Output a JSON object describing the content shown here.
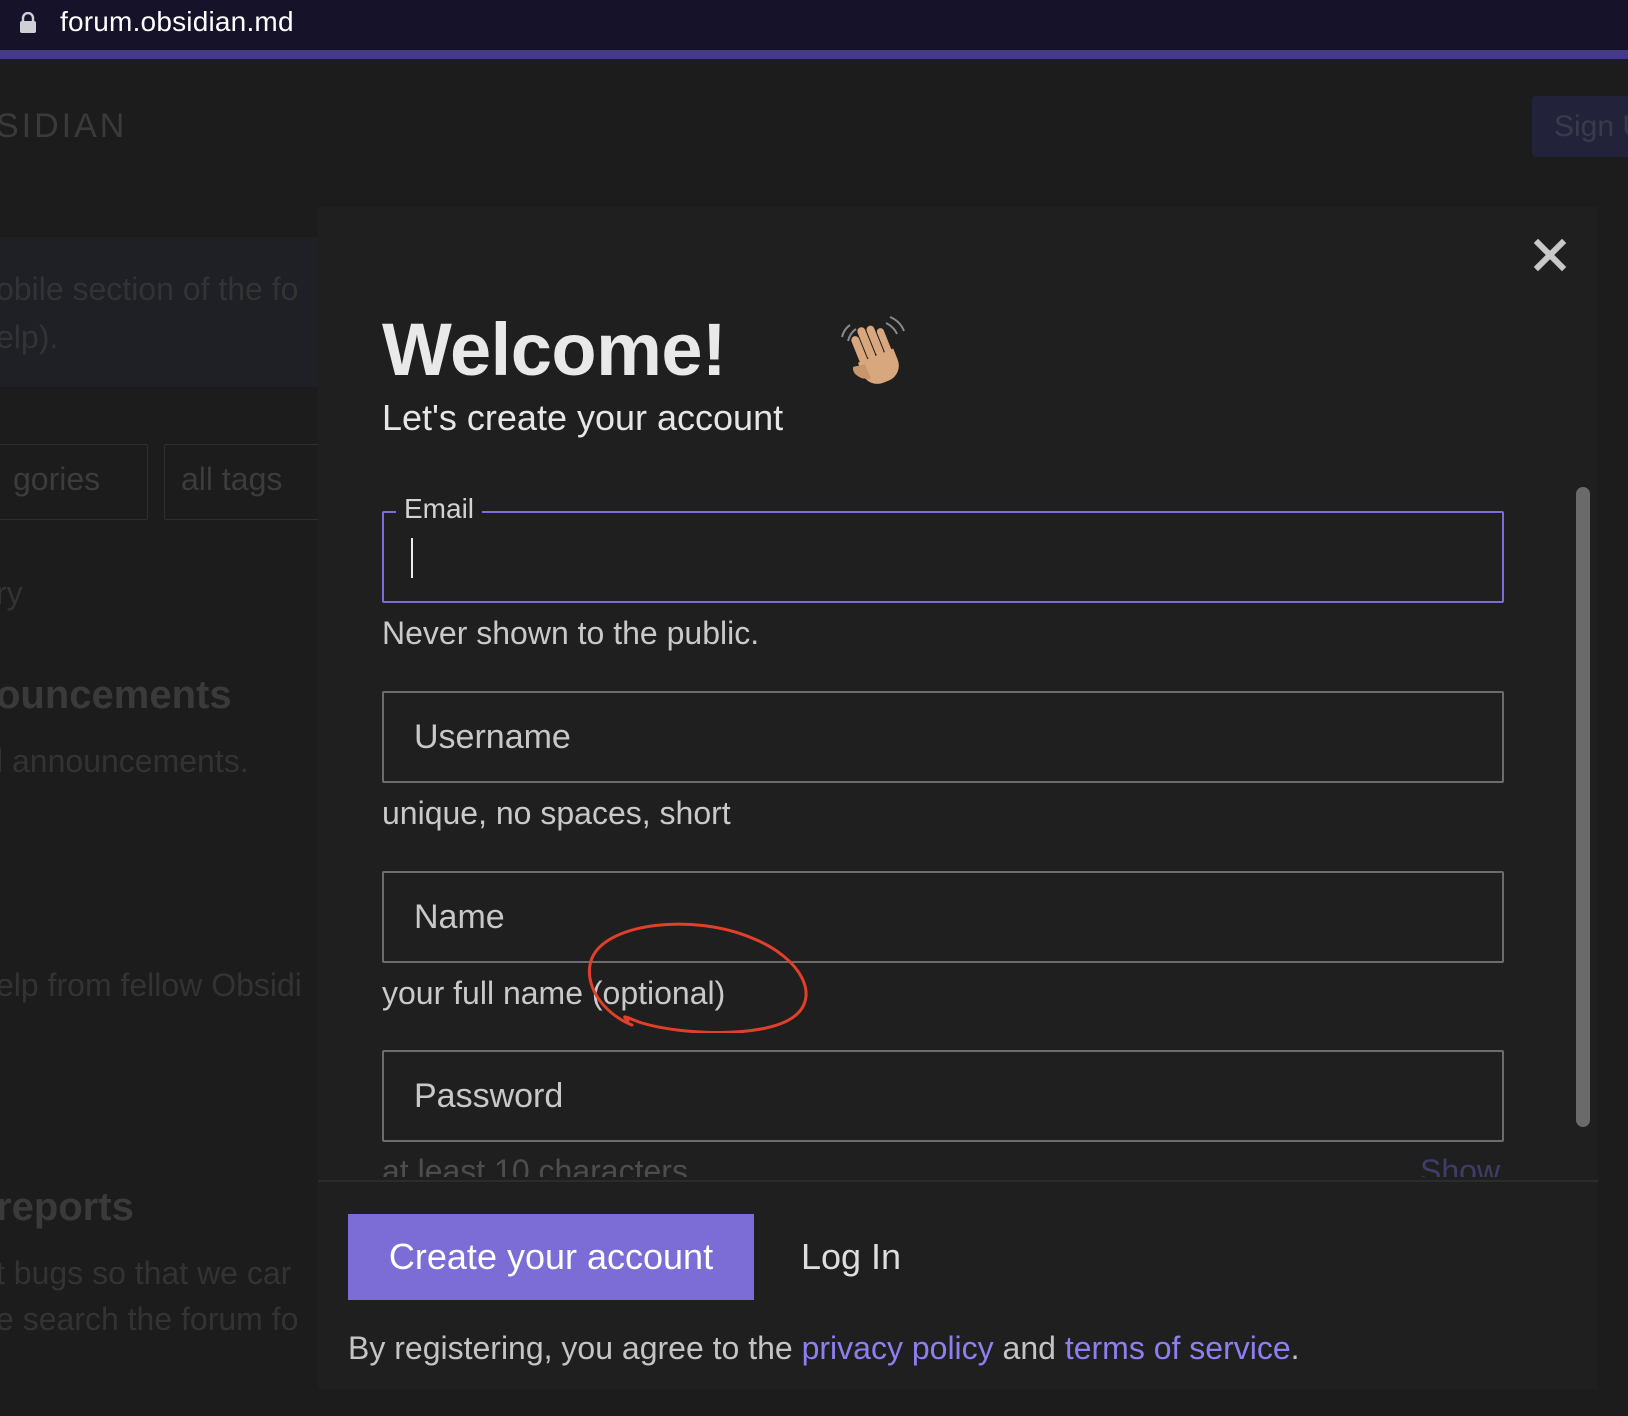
{
  "browser": {
    "url": "forum.obsidian.md"
  },
  "background": {
    "logo": "SIDIAN",
    "signup_label": "Sign U",
    "banner_line1": "obile section of the fo",
    "banner_line2": "elp).",
    "chip_categories": "gories",
    "chip_tags": "all tags",
    "category_label": "ry",
    "announcements_title": "ouncements",
    "announcements_desc": "l announcements.",
    "help_desc": "elp from fellow Obsidi",
    "reports_title": "reports",
    "reports_line1": "t bugs so that we car",
    "reports_line2": "e search the forum fo"
  },
  "modal": {
    "title": "Welcome!",
    "subtitle": "Let's create your account",
    "email": {
      "label": "Email",
      "value": "",
      "hint": "Never shown to the public."
    },
    "username": {
      "placeholder": "Username",
      "hint": "unique, no spaces, short"
    },
    "name": {
      "placeholder": "Name",
      "hint": "your full name (optional)"
    },
    "password": {
      "placeholder": "Password",
      "hint": "at least 10 characters",
      "show_label": "Show"
    },
    "footer": {
      "create_label": "Create your account",
      "login_label": "Log In",
      "legal_prefix": "By registering, you agree to the ",
      "privacy_link": "privacy policy",
      "legal_and": " and ",
      "terms_link": "terms of service",
      "legal_suffix": "."
    }
  },
  "colors": {
    "accent": "#7b6cd6",
    "link": "#8d7ff0",
    "annotation": "#e0402a",
    "modal_bg": "#1f1f1f"
  },
  "icons": {
    "lock": "lock-icon",
    "close": "close-icon",
    "wave": "waving-hand-icon"
  }
}
